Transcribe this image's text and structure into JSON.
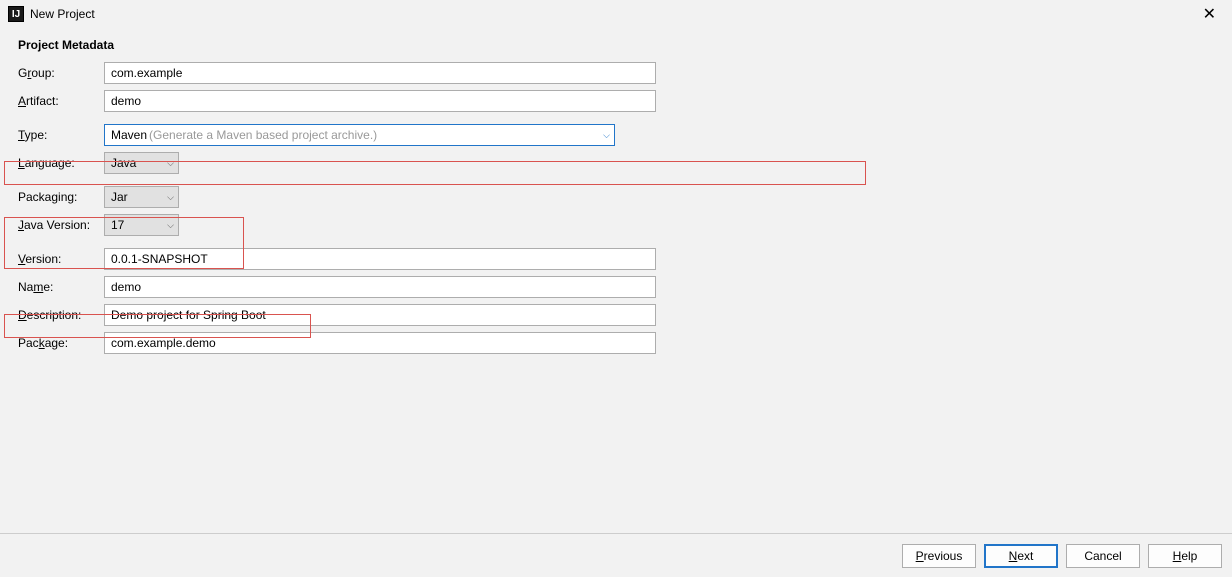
{
  "window": {
    "title": "New Project",
    "icon_glyph": "IJ"
  },
  "section_title": "Project Metadata",
  "labels": {
    "group_pre": "G",
    "group_u": "r",
    "group_post": "oup:",
    "artifact_pre": "",
    "artifact_u": "A",
    "artifact_post": "rtifact:",
    "type_pre": "",
    "type_u": "T",
    "type_post": "ype:",
    "language_pre": "",
    "language_u": "L",
    "language_post": "anguage:",
    "packaging_pre": "Packa",
    "packaging_u": "g",
    "packaging_post": "ing:",
    "javaver_pre": "",
    "javaver_u": "J",
    "javaver_post": "ava Version:",
    "version_pre": "",
    "version_u": "V",
    "version_post": "ersion:",
    "name_pre": "Na",
    "name_u": "m",
    "name_post": "e:",
    "description_pre": "",
    "description_u": "D",
    "description_post": "escription:",
    "package_pre": "Pac",
    "package_u": "k",
    "package_post": "age:"
  },
  "fields": {
    "group": "com.example",
    "artifact": "demo",
    "type_value": "Maven",
    "type_hint": "(Generate a Maven based project archive.)",
    "language": "Java",
    "packaging": "Jar",
    "java_version": "17",
    "version": "0.0.1-SNAPSHOT",
    "name": "demo",
    "description": "Demo project for Spring Boot",
    "package": "com.example.demo"
  },
  "buttons": {
    "previous_u": "P",
    "previous_post": "revious",
    "next_u": "N",
    "next_post": "ext",
    "cancel": "Cancel",
    "help_u": "H",
    "help_post": "elp"
  }
}
